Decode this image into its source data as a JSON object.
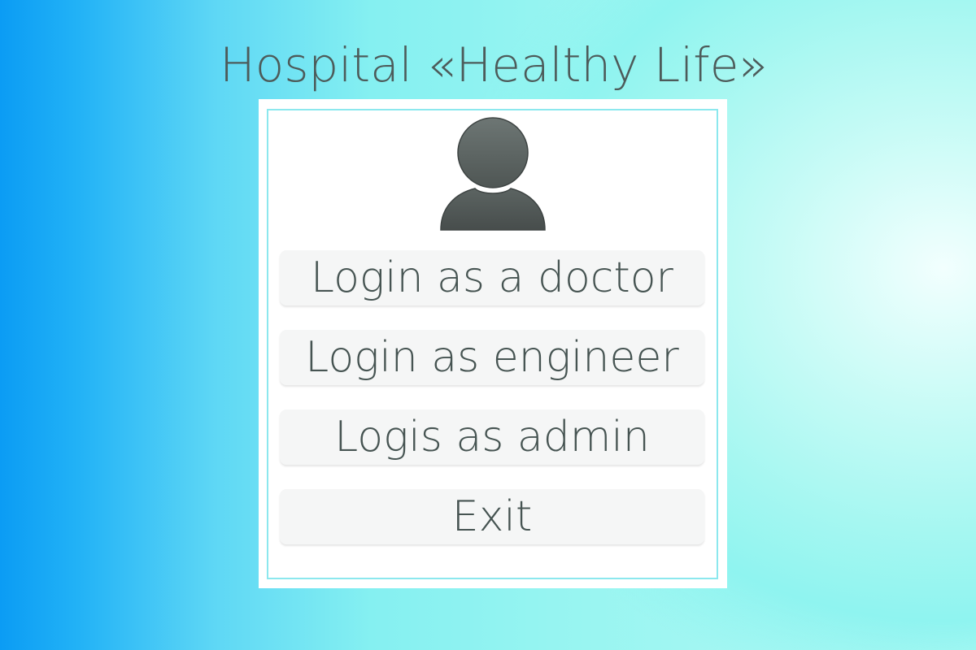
{
  "app": {
    "title": "Hospital «Healthy Life»"
  },
  "panel": {
    "avatar_icon": "user-avatar-icon",
    "buttons": [
      {
        "id": "doctor",
        "label": "Login as a doctor"
      },
      {
        "id": "engineer",
        "label": "Login as engineer"
      },
      {
        "id": "admin",
        "label": "Logis as admin"
      },
      {
        "id": "exit",
        "label": "Exit"
      }
    ]
  },
  "colors": {
    "background_left": "#0b9cf4",
    "background_right": "#a6f7f1",
    "panel_background": "#ffffff",
    "panel_border": "#8ce8ee",
    "button_background": "#f5f6f6",
    "text": "#465452",
    "avatar": "#555c5a"
  }
}
